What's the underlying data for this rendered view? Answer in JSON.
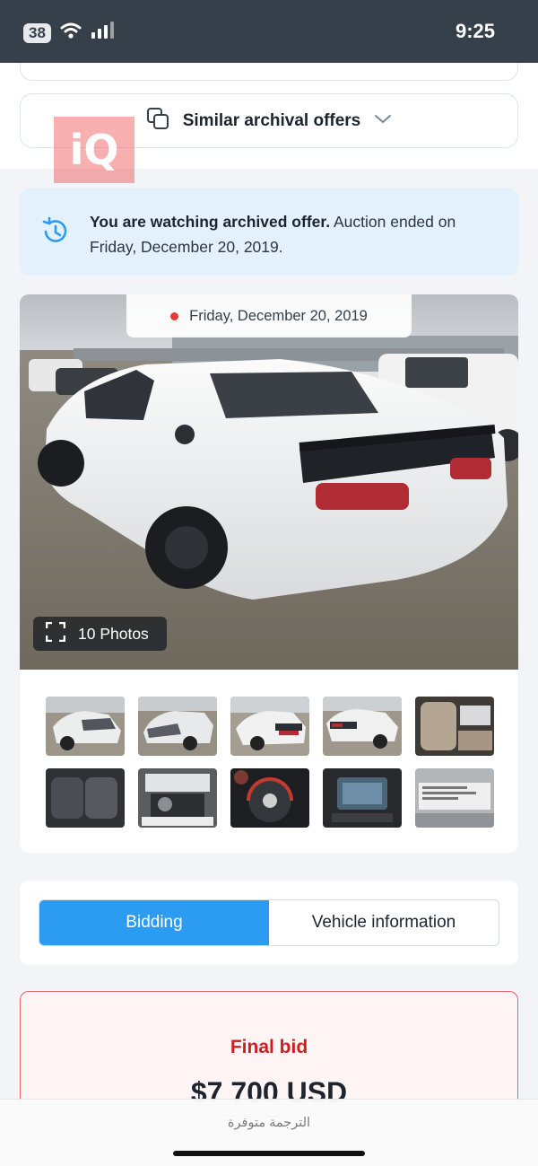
{
  "status_bar": {
    "battery": "38",
    "time": "9:25",
    "icons": [
      "wifi-icon",
      "signal-icon"
    ]
  },
  "similar": {
    "label": "Similar archival offers",
    "icon": "copy-icon",
    "chevron": "chevron-down-icon"
  },
  "watermark": {
    "text": "iQ"
  },
  "archived_notice": {
    "bold": "You are watching archived offer.",
    "rest": " Auction ended on Friday, December 20, 2019.",
    "icon": "history-icon",
    "color": "#e3f1fc"
  },
  "gallery": {
    "date": "Friday, December 20, 2019",
    "photos_label": "10 Photos",
    "thumbnails": [
      "white-car-front-damaged",
      "white-car-front-damaged-2",
      "white-car-rear",
      "white-car-rear-side",
      "interior-front-seats",
      "interior-rear-seats",
      "engine-bay",
      "instrument-cluster",
      "infotainment-screen",
      "door-label-sticker"
    ]
  },
  "tabs": {
    "items": [
      {
        "label": "Bidding",
        "active": true
      },
      {
        "label": "Vehicle information",
        "active": false
      }
    ],
    "accent": "#2b9cf2"
  },
  "final_bid": {
    "label": "Final bid",
    "value": "$7 700 USD",
    "color": "#cc1f1f"
  },
  "bottom_bar": {
    "translate_text": "الترجمة متوفرة"
  }
}
